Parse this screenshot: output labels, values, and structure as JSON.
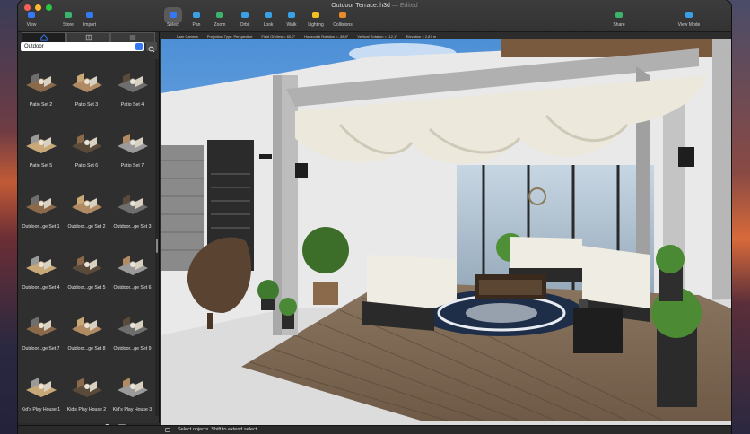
{
  "window": {
    "title": "Outdoor Terrace.lh3d",
    "edited_label": "— Edited"
  },
  "toolbar": {
    "buttons": [
      {
        "label": "View",
        "icon": "view-icon",
        "color": "#3478f6"
      },
      {
        "label": "Store",
        "icon": "store-icon",
        "color": "#3bb36a"
      },
      {
        "label": "Import",
        "icon": "import-icon",
        "color": "#3478f6"
      },
      {
        "label": "Select",
        "icon": "pointer-icon",
        "color": "#3478f6",
        "active": true
      },
      {
        "label": "Pan",
        "icon": "pan-icon",
        "color": "#3aa0e6"
      },
      {
        "label": "Zoom",
        "icon": "zoom-icon",
        "color": "#3bb36a"
      },
      {
        "label": "Orbit",
        "icon": "orbit-icon",
        "color": "#3aa0e6"
      },
      {
        "label": "Look",
        "icon": "look-icon",
        "color": "#3aa0e6"
      },
      {
        "label": "Walk",
        "icon": "walk-icon",
        "color": "#3aa0e6"
      },
      {
        "label": "Lighting",
        "icon": "lightbulb-icon",
        "color": "#f0c020"
      },
      {
        "label": "Collisions",
        "icon": "collisions-icon",
        "color": "#e88a2a"
      },
      {
        "label": "Share",
        "icon": "share-icon",
        "color": "#3bb36a"
      },
      {
        "label": "View Mode",
        "icon": "view-mode-icon",
        "color": "#3aa0e6"
      }
    ]
  },
  "library": {
    "category": "Outdoor",
    "items": [
      {
        "label": "Patio Set 2"
      },
      {
        "label": "Patio Set 3"
      },
      {
        "label": "Patio Set 4"
      },
      {
        "label": "Patio Set 5"
      },
      {
        "label": "Patio Set 6"
      },
      {
        "label": "Patio Set 7"
      },
      {
        "label": "Outdoor...ge Set 1"
      },
      {
        "label": "Outdoor...ge Set 2"
      },
      {
        "label": "Outdoor...ge Set 3"
      },
      {
        "label": "Outdoor...ge Set 4"
      },
      {
        "label": "Outdoor...ge Set 5"
      },
      {
        "label": "Outdoor...ge Set 6"
      },
      {
        "label": "Outdoor...ge Set 7"
      },
      {
        "label": "Outdoor...ge Set 8"
      },
      {
        "label": "Outdoor...ge Set 9"
      },
      {
        "label": "Kid's Play House 1"
      },
      {
        "label": "Kid's Play House 2"
      },
      {
        "label": "Kid's Play House 3"
      }
    ]
  },
  "camera_bar": {
    "items": [
      "User Camera",
      "Projection Type: Perspective",
      "Field Of View = 60,0°",
      "Horizontal Rotation = -38,8°",
      "Vertical Rotation = -12,1°",
      "Elevation = 2,87 m"
    ]
  },
  "status": {
    "message": "Select objects. Shift to extend select."
  },
  "colors": {
    "accent": "#3478f6",
    "toolbar_bg": "#333333",
    "panel_bg": "#2f2f2f"
  }
}
